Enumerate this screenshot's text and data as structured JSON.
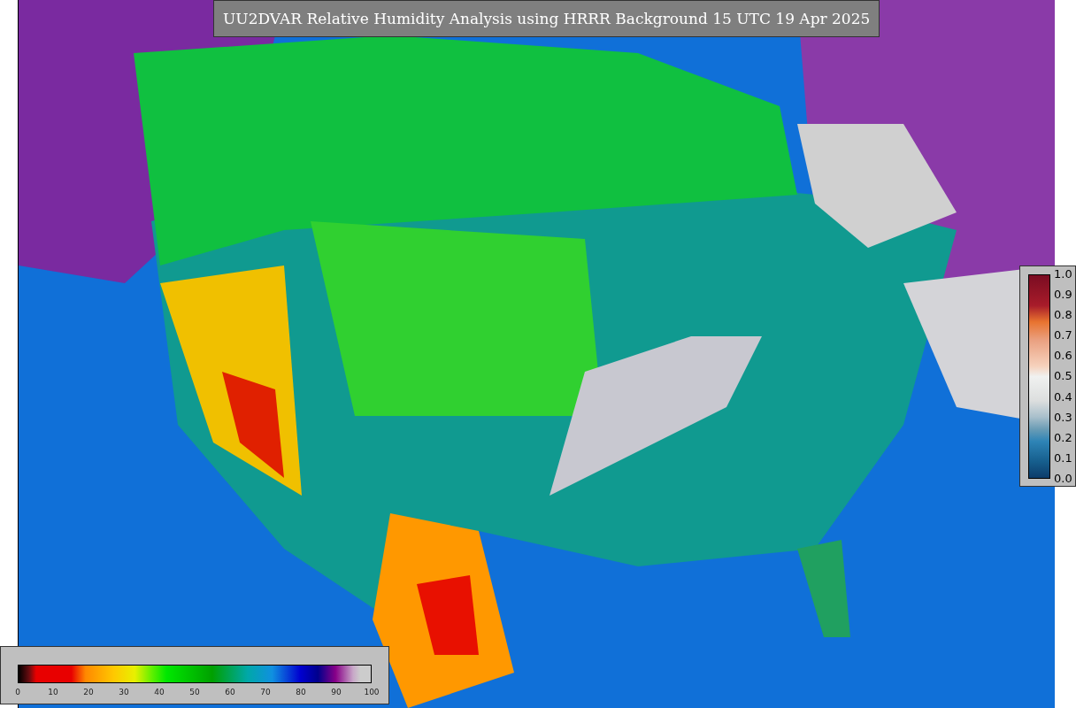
{
  "title": "UU2DVAR Relative Humidity Analysis using HRRR Background 15 UTC 19 Apr 2025",
  "side_legend": {
    "labels": [
      "1.0",
      "0.9",
      "0.8",
      "0.7",
      "0.6",
      "0.5",
      "0.4",
      "0.3",
      "0.2",
      "0.1",
      "0.0"
    ]
  },
  "bottom_legend": {
    "labels": [
      "0",
      "10",
      "20",
      "30",
      "40",
      "50",
      "60",
      "70",
      "80",
      "90",
      "100"
    ]
  }
}
